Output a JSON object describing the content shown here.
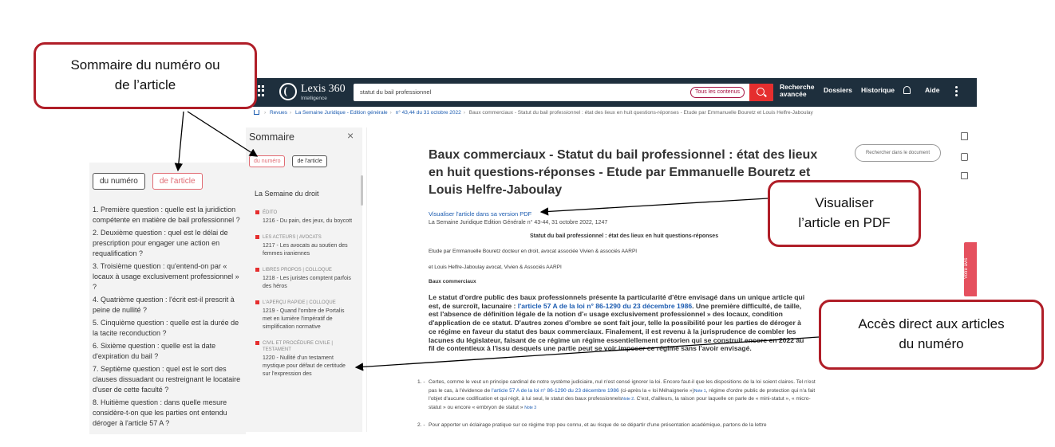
{
  "callouts": {
    "summary_line1": "Sommaire du numéro ou",
    "summary_line2": "de l’article",
    "pdf_line1": "Visualiser",
    "pdf_line2": "l’article en PDF",
    "direct_line1": "Accès direct aux articles",
    "direct_line2": "du numéro"
  },
  "zoom": {
    "tab_issue": "du numéro",
    "tab_article": "de l'article",
    "questions": [
      "1. Première question : quelle est la juridiction compétente en matière de bail professionnel ?",
      "2. Deuxième question : quel est le délai de prescription pour engager une action en requalification ?",
      "3. Troisième question : qu'entend-on par « locaux à usage exclusivement professionnel » ?",
      "4. Quatrième question : l'écrit est-il prescrit à peine de nullité ?",
      "5. Cinquième question : quelle est la durée de la tacite reconduction ?",
      "6. Sixième question : quelle est la date d'expiration du bail ?",
      "7. Septième question : quel est le sort des clauses dissuadant ou restreignant le locataire d'user de cette faculté ?",
      "8. Huitième question : dans quelle mesure considère-t-on que les parties ont entendu déroger à l'article 57 A ?"
    ]
  },
  "topbar": {
    "logo": "Lexis 360",
    "logo_sub": "Intelligence",
    "search_value": "statut du bail professionnel",
    "scope": "Tous les contenus",
    "adv_line1": "Recherche",
    "adv_line2": "avancée",
    "dossiers": "Dossiers",
    "historique": "Historique",
    "aide": "Aide"
  },
  "breadcrumb": {
    "revues": "Revues",
    "journal": "La Semaine Juridique - Edition générale",
    "issue": "n° 43,44 du 31 octobre 2022",
    "current": "Baux commerciaux - Statut du bail professionnel : état des lieux en huit questions-réponses - Etude par Emmanuelle Bouretz et Louis Helfre-Jaboulay"
  },
  "sidebar": {
    "title": "Sommaire",
    "close": "×",
    "tab_issue": "du numéro",
    "tab_article": "de l'article",
    "issue_title": "La Semaine du droit",
    "items": [
      {
        "rubric": "ÉDITO",
        "entry": "1216 - Du pain, des jeux, du boycott"
      },
      {
        "rubric": "LES ACTEURS | AVOCATS",
        "entry": "1217 - Les avocats au soutien des femmes iraniennes"
      },
      {
        "rubric": "LIBRES PROPOS | COLLOQUE",
        "entry": "1218 - Les juristes comptent parfois des héros"
      },
      {
        "rubric": "L'APERÇU RAPIDE | COLLOQUE",
        "entry": "1219 - Quand l'ombre de Portalis met en lumière l'impératif de simplification normative"
      },
      {
        "rubric": "CIVIL ET PROCÉDURE CIVILE | TESTAMENT",
        "entry": "1220 - Nullité d'un testament mystique pour défaut de certitude sur l'expression des"
      }
    ]
  },
  "doc": {
    "title": "Baux commerciaux - Statut du bail professionnel : état des lieux en huit questions-réponses - Etude par Emmanuelle Bouretz et Louis Helfre-Jaboulay",
    "find_placeholder": "Rechercher dans le document",
    "pdf_link": "Visualiser l'article dans sa version PDF",
    "citation": "La Semaine Juridique Edition Générale n° 43-44, 31 octobre 2022, 1247",
    "subheading": "Statut du bail professionnel : état des lieux en huit questions-réponses",
    "author1": "Etude par Emmanuelle Bouretz docteur en droit, avocat associée Vivien & associés AARPI",
    "author2": "et Louis Helfre-Jaboulay avocat, Vivien & Associés AARPI",
    "category": "Baux commerciaux",
    "abstract_a": "Le statut d'ordre public des baux professionnels présente la particularité d'être envisagé dans un unique article qui est, de surcroît, lacunaire : ",
    "abstract_link": "l'article 57 A de la loi n° 86-1290 du 23 décembre 1986",
    "abstract_b": ". Une première difficulté, de taille, est l'absence de définition légale de la notion d'« usage exclusivement professionnel » des locaux, condition d'application de ce statut. D'autres zones d'ombre se sont fait jour, telle la possibilité pour les parties de déroger à ce régime en faveur du statut des baux commerciaux. Finalement, il est revenu à la jurisprudence de combler les lacunes du législateur, faisant de ce régime un régime essentiellement prétorien qui se construit encore en 2022 au fil de contentieux à l'issu desquels une partie peut se voir imposer ce régime sans l'avoir envisagé.",
    "p1_num": "1. -",
    "p1_a": "Certes, comme le veut un principe cardinal de notre système judiciaire, nul n'est censé ignorer la loi. Encore faut-il que les dispositions de la loi soient claires. Tel n'est pas le cas, à l'évidence de ",
    "p1_link": "l'article 57 A de la loi n° 86-1290 du 23 décembre 1986",
    "p1_b": " (ci-après la « loi Méhaignerie »)",
    "p1_note1": "Note 1",
    "p1_c": ", régime d'ordre public de protection qui n'a fait l'objet d'aucune codification et qui régit, à lui seul, le statut des baux professionnels",
    "p1_note2": "Note 2",
    "p1_d": ". C'est, d'ailleurs, la raison pour laquelle on parle de « mini-statut », « micro-statut » ou encore « embryon de statut »",
    "p1_note3": "Note 3",
    "p2_num": "2. -",
    "p2": "Pour apporter un éclairage pratique sur ce régime trop peu connu, et au risque de se départir d'une présentation académique, partons de la lettre",
    "feedback": "Votre avis"
  },
  "colors": {
    "callout_border": "#b01e28",
    "topbar": "#1e2f3d",
    "accent_red": "#e52e2e",
    "link_blue": "#1b5bb0"
  }
}
